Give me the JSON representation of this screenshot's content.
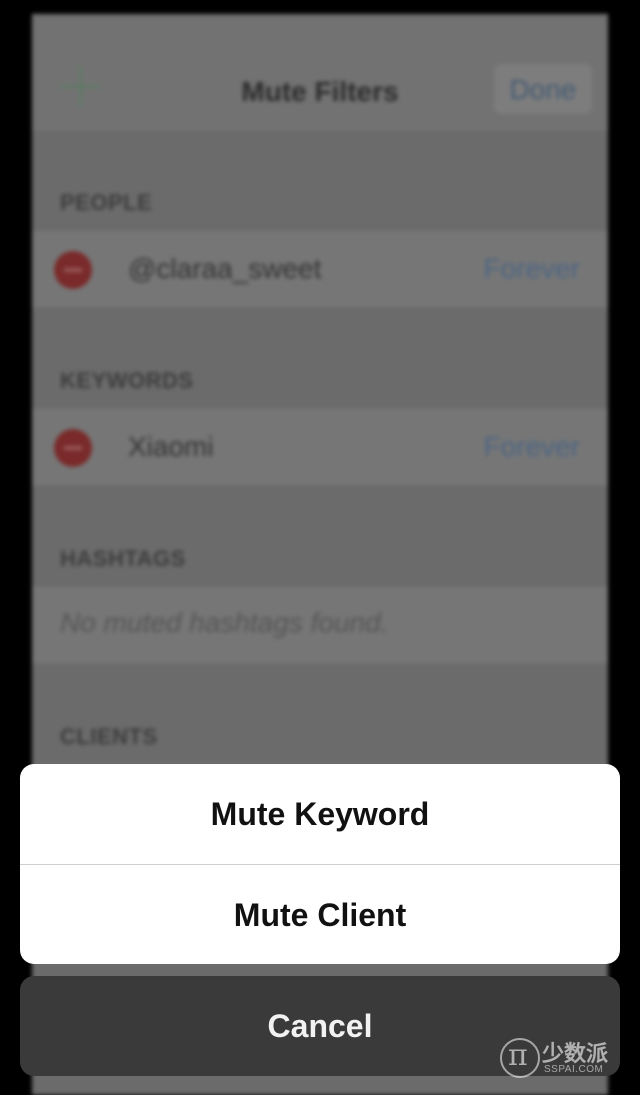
{
  "background_screen": {
    "nav": {
      "title": "Mute Filters",
      "done_label": "Done",
      "add_icon": "plus-icon"
    },
    "sections": {
      "people": {
        "header": "PEOPLE",
        "rows": [
          {
            "label": "@claraa_sweet",
            "duration": "Forever"
          }
        ]
      },
      "keywords": {
        "header": "KEYWORDS",
        "rows": [
          {
            "label": "Xiaomi",
            "duration": "Forever"
          }
        ]
      },
      "hashtags": {
        "header": "HASHTAGS",
        "empty_text": "No muted hashtags found."
      },
      "clients": {
        "header": "CLIENTS"
      }
    }
  },
  "action_sheet": {
    "options": [
      {
        "label": "Mute Keyword"
      },
      {
        "label": "Mute Client"
      }
    ],
    "cancel_label": "Cancel"
  },
  "watermark": {
    "cn": "少数派",
    "en": "SSPAI.COM"
  },
  "colors": {
    "overlay_bg": "#6b6b6b",
    "sheet_bg": "#ffffff",
    "cancel_bg": "#3a3a3a",
    "forever_link": "#4c6583"
  }
}
